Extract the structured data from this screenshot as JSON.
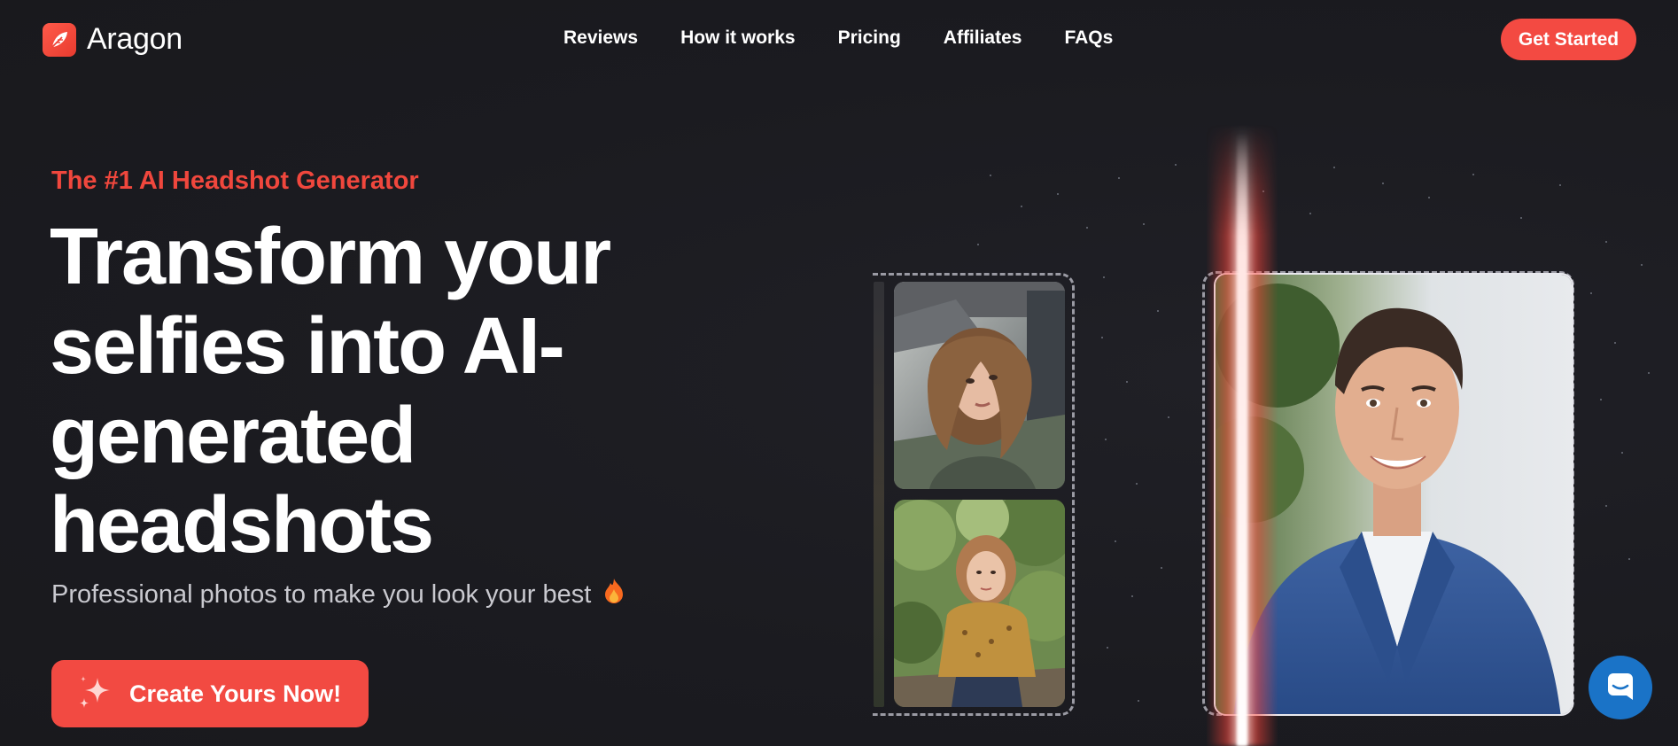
{
  "brand": {
    "name": "Aragon",
    "accent": "#f34a42"
  },
  "nav": {
    "links": [
      "Reviews",
      "How it works",
      "Pricing",
      "Affiliates",
      "FAQs"
    ],
    "cta_label": "Get Started"
  },
  "hero": {
    "eyebrow": "The #1 AI Headshot Generator",
    "headline": "Transform your selfies into AI-generated headshots",
    "subline": "Professional photos to make you look your best",
    "subline_icon": "fire-icon",
    "cta_label": "Create Yours Now!",
    "cta_icon": "sparkle-icon"
  },
  "visual": {
    "selfies": [
      "selfie-woman-in-car",
      "selfie-woman-outdoors"
    ],
    "result": "professional-headshot-man-blue-suit"
  },
  "chat": {
    "icon": "chat-icon",
    "color": "#1a73c7"
  }
}
